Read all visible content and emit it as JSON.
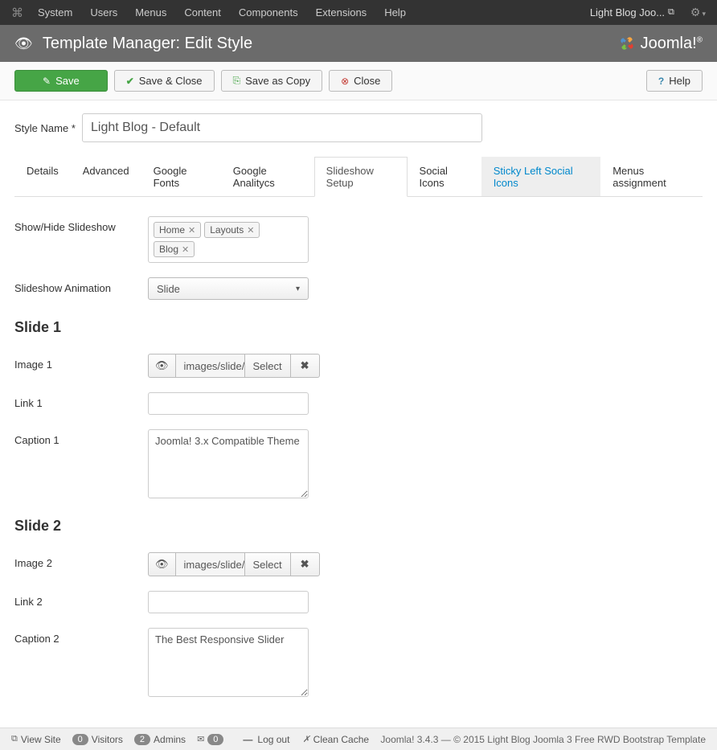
{
  "top_menu": {
    "items": [
      "System",
      "Users",
      "Menus",
      "Content",
      "Components",
      "Extensions",
      "Help"
    ],
    "site_link": "Light Blog Joo..."
  },
  "page_header": {
    "title": "Template Manager: Edit Style",
    "brand": "Joomla!"
  },
  "toolbar": {
    "save": "Save",
    "save_close": "Save & Close",
    "save_copy": "Save as Copy",
    "close": "Close",
    "help": "Help"
  },
  "style_name": {
    "label": "Style Name",
    "value": "Light Blog - Default"
  },
  "tabs": [
    "Details",
    "Advanced",
    "Google Fonts",
    "Google Analitycs",
    "Slideshow Setup",
    "Social Icons",
    "Sticky Left Social Icons",
    "Menus assignment"
  ],
  "active_tab_index": 4,
  "highlight_tab_index": 6,
  "slideshow": {
    "show_hide_label": "Show/Hide Slideshow",
    "tags": [
      "Home",
      "Layouts",
      "Blog"
    ],
    "animation_label": "Slideshow Animation",
    "animation_value": "Slide"
  },
  "slides": [
    {
      "heading": "Slide 1",
      "image_label": "Image 1",
      "image_path": "images/slide/sli",
      "select_label": "Select",
      "link_label": "Link 1",
      "link_value": "",
      "caption_label": "Caption 1",
      "caption_value": "Joomla! 3.x Compatible Theme"
    },
    {
      "heading": "Slide 2",
      "image_label": "Image 2",
      "image_path": "images/slide/sli",
      "select_label": "Select",
      "link_label": "Link 2",
      "link_value": "",
      "caption_label": "Caption 2",
      "caption_value": "The Best Responsive Slider"
    }
  ],
  "footer": {
    "view_site": "View Site",
    "visitors_count": "0",
    "visitors": "Visitors",
    "admins_count": "2",
    "admins": "Admins",
    "msg_count": "0",
    "logout": "Log out",
    "clean_cache": "Clean Cache",
    "copyright": "Joomla! 3.4.3 — © 2015 Light Blog Joomla 3 Free RWD Bootstrap Template"
  }
}
